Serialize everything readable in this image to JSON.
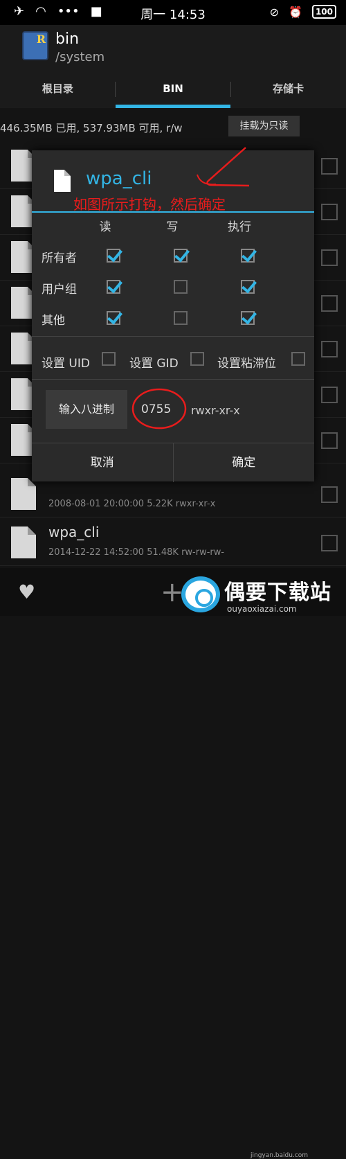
{
  "statusbar": {
    "time": "周一 14:53",
    "battery": "100"
  },
  "header": {
    "title": "bin",
    "subtitle": "/system"
  },
  "tabs": [
    {
      "label": "根目录"
    },
    {
      "label": "BIN"
    },
    {
      "label": "存储卡"
    }
  ],
  "storage": {
    "text": "446.35MB 已用, 537.93MB 可用, r/w",
    "mount_button": "挂载为只读"
  },
  "files": [
    {
      "name": "",
      "meta": ""
    },
    {
      "name": "",
      "meta": ""
    },
    {
      "name": "",
      "meta": ""
    },
    {
      "name": "",
      "meta": ""
    },
    {
      "name": "",
      "meta": ""
    },
    {
      "name": "",
      "meta": ""
    },
    {
      "name": "",
      "meta": ""
    },
    {
      "name": "",
      "meta": "2008-08-01 20:00:00  5.22K  rwxr-xr-x"
    },
    {
      "name": "wpa_cli",
      "meta": "2014-12-22 14:52:00  51.48K  rw-rw-rw-"
    }
  ],
  "dialog": {
    "title": "wpa_cli",
    "annotation": "如图所示打钩，然后确定",
    "columns": [
      "读",
      "写",
      "执行"
    ],
    "rows": [
      {
        "label": "所有者",
        "checks": [
          true,
          true,
          true
        ]
      },
      {
        "label": "用户组",
        "checks": [
          true,
          false,
          true
        ]
      },
      {
        "label": "其他",
        "checks": [
          true,
          false,
          true
        ]
      }
    ],
    "special": [
      {
        "label": "设置 UID",
        "checked": false
      },
      {
        "label": "设置 GID",
        "checked": false
      },
      {
        "label": "设置粘滞位",
        "checked": false
      }
    ],
    "octal_button": "输入八进制",
    "octal_value": "0755",
    "octal_string": "rwxr-xr-x",
    "cancel": "取消",
    "confirm": "确定"
  },
  "watermark": {
    "text": "偶要下载站",
    "url": "ouyaoxiazai.com",
    "source": "jingyan.baidu.com"
  },
  "colors": {
    "accent": "#33b5e5",
    "annotation": "#e81c1c"
  }
}
